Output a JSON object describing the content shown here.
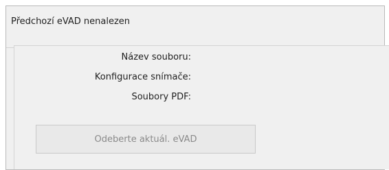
{
  "panel": {
    "title": "Předchozí eVAD nenalezen",
    "fields": {
      "file_name_label": "Název souboru:",
      "scanner_config_label": "Konfigurace snímače:",
      "pdf_files_label": "Soubory PDF:"
    },
    "remove_button_label": "Odeberte aktuál. eVAD",
    "remove_button_state": "disabled"
  }
}
